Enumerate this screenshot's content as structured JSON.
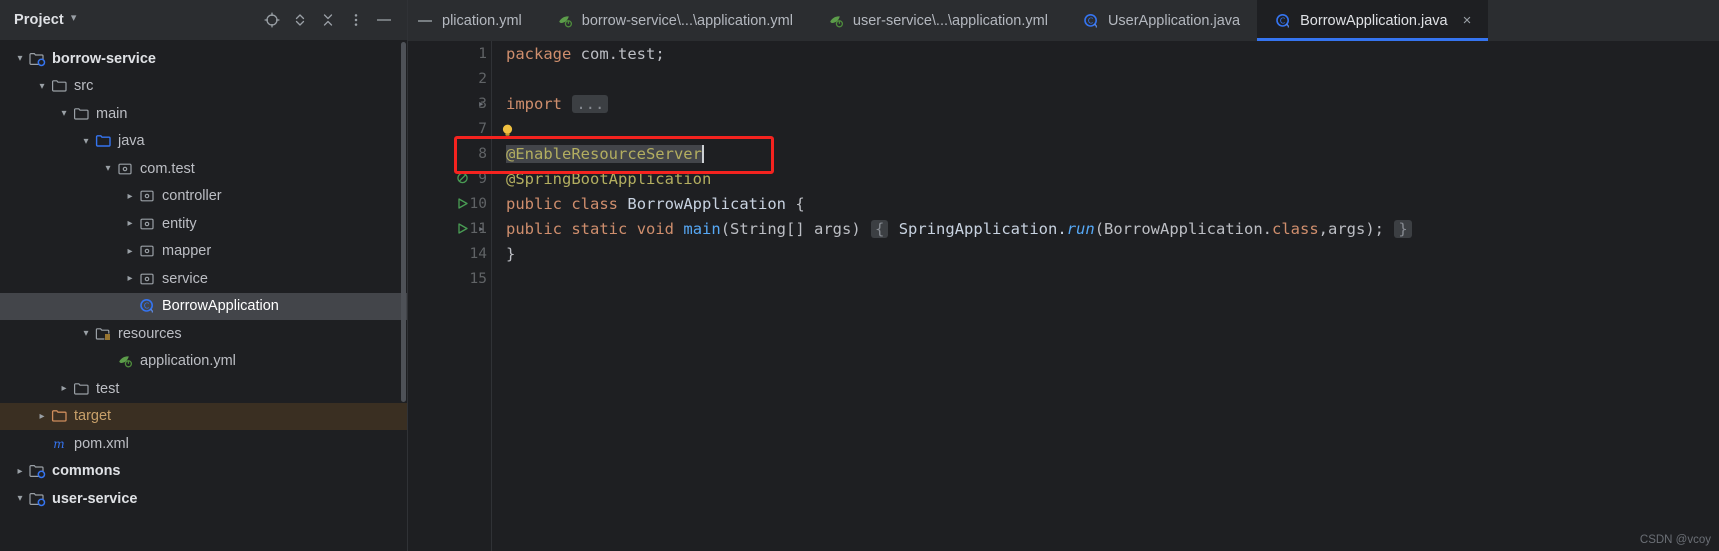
{
  "panel": {
    "title": "Project",
    "title_chevron": "chevron-down",
    "toolbar": [
      {
        "name": "locate-icon",
        "label": "Select Opened File"
      },
      {
        "name": "expand-all-icon",
        "label": "Expand All"
      },
      {
        "name": "collapse-all-icon",
        "label": "Collapse All"
      },
      {
        "name": "more-options-icon",
        "label": "Options"
      },
      {
        "name": "hide-icon",
        "label": "Hide"
      }
    ],
    "tree": [
      {
        "label": "borrow-service",
        "indent": 1,
        "arrow": "down",
        "icon": "module-folder",
        "kind": "module"
      },
      {
        "label": "src",
        "indent": 2,
        "arrow": "down",
        "icon": "folder",
        "kind": "folder"
      },
      {
        "label": "main",
        "indent": 3,
        "arrow": "down",
        "icon": "folder",
        "kind": "folder"
      },
      {
        "label": "java",
        "indent": 4,
        "arrow": "down",
        "icon": "source-root",
        "kind": "folder"
      },
      {
        "label": "com.test",
        "indent": 5,
        "arrow": "down",
        "icon": "package",
        "kind": "package"
      },
      {
        "label": "controller",
        "indent": 6,
        "arrow": "right",
        "icon": "package",
        "kind": "package"
      },
      {
        "label": "entity",
        "indent": 6,
        "arrow": "right",
        "icon": "package",
        "kind": "package"
      },
      {
        "label": "mapper",
        "indent": 6,
        "arrow": "right",
        "icon": "package",
        "kind": "package"
      },
      {
        "label": "service",
        "indent": 6,
        "arrow": "right",
        "icon": "package",
        "kind": "package"
      },
      {
        "label": "BorrowApplication",
        "indent": 6,
        "arrow": "none",
        "icon": "spring-class",
        "kind": "file",
        "selected": true
      },
      {
        "label": "resources",
        "indent": 4,
        "arrow": "down",
        "icon": "resource-root",
        "kind": "folder"
      },
      {
        "label": "application.yml",
        "indent": 5,
        "arrow": "none",
        "icon": "spring-yml",
        "kind": "file"
      },
      {
        "label": "test",
        "indent": 3,
        "arrow": "right",
        "icon": "folder",
        "kind": "folder"
      },
      {
        "label": "target",
        "indent": 2,
        "arrow": "right",
        "icon": "excluded-folder",
        "kind": "folder",
        "excluded": true
      },
      {
        "label": "pom.xml",
        "indent": 2,
        "arrow": "none",
        "icon": "maven-file",
        "kind": "file"
      },
      {
        "label": "commons",
        "indent": 1,
        "arrow": "right",
        "icon": "module-folder",
        "kind": "module"
      },
      {
        "label": "user-service",
        "indent": 1,
        "arrow": "down",
        "icon": "module-folder",
        "kind": "module"
      }
    ]
  },
  "tabs": [
    {
      "label": "plication.yml",
      "icon": "none",
      "active": false,
      "clipped": true
    },
    {
      "label": "borrow-service\\...\\application.yml",
      "icon": "spring-yml",
      "active": false
    },
    {
      "label": "user-service\\...\\application.yml",
      "icon": "spring-yml",
      "active": false
    },
    {
      "label": "UserApplication.java",
      "icon": "spring-class",
      "active": false
    },
    {
      "label": "BorrowApplication.java",
      "icon": "spring-class",
      "active": true,
      "close": "×"
    }
  ],
  "editor": {
    "lines": [
      {
        "num": "1",
        "gutter": "none",
        "fold": false
      },
      {
        "num": "2",
        "gutter": "none",
        "fold": false
      },
      {
        "num": "3",
        "gutter": "none",
        "fold": true
      },
      {
        "num": "7",
        "gutter": "none",
        "fold": false
      },
      {
        "num": "8",
        "gutter": "none",
        "fold": false
      },
      {
        "num": "9",
        "gutter": "bean",
        "fold": false
      },
      {
        "num": "10",
        "gutter": "run",
        "fold": false
      },
      {
        "num": "11",
        "gutter": "run",
        "fold": true
      },
      {
        "num": "14",
        "gutter": "none",
        "fold": false
      },
      {
        "num": "15",
        "gutter": "none",
        "fold": false
      }
    ],
    "code": {
      "l1_kw": "package",
      "l1_pkg": " com.test;",
      "l3_kw": "import",
      "l3_fold": "...",
      "l8_annotation": "@EnableResourceServer",
      "l9_annotation": "@SpringBootApplication",
      "l10_kw1": "public",
      "l10_kw2": "class",
      "l10_name": "BorrowApplication",
      "l10_brace": "{",
      "l11_kw1": "public",
      "l11_kw2": "static",
      "l11_kw3": "void",
      "l11_method": "main",
      "l11_params": "(String[] args)",
      "l11_fold_open": "{",
      "l11_body_cls": "SpringApplication.",
      "l11_body_run": "run",
      "l11_body_args": "(BorrowApplication.",
      "l11_body_classkw": "class",
      "l11_body_tail": ",args);",
      "l11_fold_close": "}",
      "l14_brace": "}"
    },
    "bulb_icon": "intention-bulb-icon",
    "highlight_box": "red-annotation-highlight"
  },
  "watermark": "CSDN @vcoy",
  "colors": {
    "accent": "#3574f0",
    "highlight_red": "#f5231f",
    "excluded": "#3a2f22",
    "selection": "#43454a",
    "annotation": "#b3ae60",
    "keyword": "#cf8e6d"
  }
}
